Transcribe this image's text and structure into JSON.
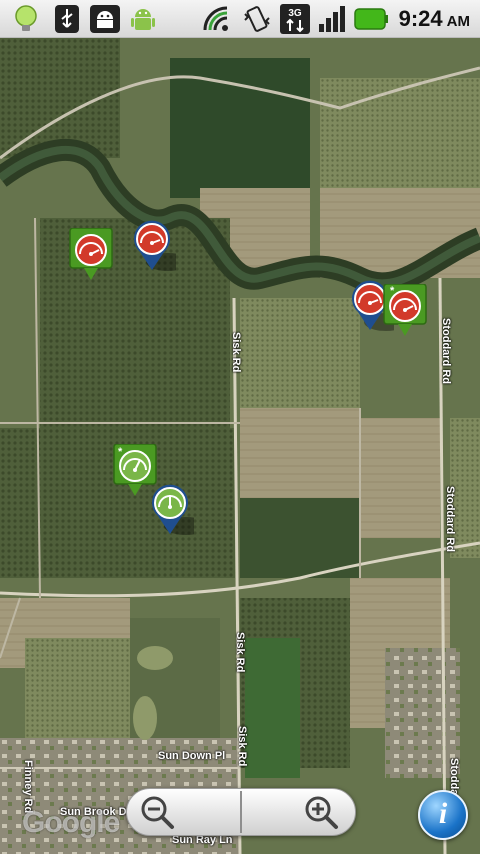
{
  "status_bar": {
    "time": "9:24",
    "ampm": "AM",
    "icons": [
      "lightbulb-icon",
      "usb-icon",
      "android-debug-icon",
      "android-icon",
      "wifi-sync-icon",
      "vibrate-icon",
      "3g-data-icon",
      "signal-icon",
      "battery-icon"
    ],
    "battery_color": "#43b71a"
  },
  "map": {
    "roads": {
      "sisk_rd_1": "Sisk Rd",
      "sisk_rd_2": "Sisk Rd",
      "sisk_rd_3": "Sisk Rd",
      "stoddard_rd_1": "Stoddard Rd",
      "stoddard_rd_2": "Stoddard Rd",
      "stoddard_rd_3": "Stoddard",
      "sun_down_pl": "Sun Down Pl",
      "sun_brook_dr": "Sun Brook Dr",
      "finney_rd": "Finney Rd",
      "sun_ray_ln": "Sun Ray Ln"
    },
    "markers": [
      {
        "style": "green-square",
        "gauge": "red"
      },
      {
        "style": "blue-pin",
        "gauge": "red"
      },
      {
        "style": "blue-pin",
        "gauge": "red"
      },
      {
        "style": "green-square",
        "gauge": "red",
        "badge": "*"
      },
      {
        "style": "green-square",
        "gauge": "green",
        "badge": "*"
      },
      {
        "style": "blue-pin",
        "gauge": "green"
      }
    ],
    "google_logo": "Google",
    "info_label": "i"
  },
  "colors": {
    "marker_green": "#4a9a22",
    "marker_blue": "#1f4e8f",
    "gauge_red": "#d23a2a",
    "gauge_green": "#7ab648"
  }
}
